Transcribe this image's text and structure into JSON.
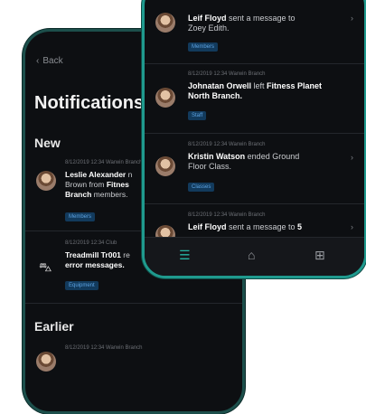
{
  "back_screen": {
    "back_label": "Back",
    "title": "Notifications",
    "section_new": "New",
    "section_earlier": "Earlier",
    "items": [
      {
        "meta": "8/12/2019   12:34   Warwin Branch",
        "name": "Leslie Alexander",
        "text_rest": " n",
        "line2": "Brown from ",
        "line2_bold": "Fitnes",
        "line3_bold": "Branch",
        "line3": " members.",
        "tag": "Members"
      },
      {
        "meta": "8/12/2019   12:34   Club",
        "line1_bold": "Treadmill Tr001",
        "line1": " re",
        "line2_bold": "error messages.",
        "tag": "Equipment"
      },
      {
        "meta": "8/12/2019   12:34   Warwin Branch"
      }
    ]
  },
  "front_screen": {
    "items": [
      {
        "name": "Leif Floyd",
        "text": " sent a message to",
        "line2": "Zoey Edith.",
        "tag": "Members"
      },
      {
        "meta": "8/12/2019   12:34   Warwin Branch",
        "name": "Johnatan Orwell",
        "text": " left ",
        "bold2": "Fitness Planet",
        "line2_bold": "North Branch.",
        "tag": "Staff"
      },
      {
        "meta": "8/12/2019   12:34   Warwin Branch",
        "name": "Kristin Watson",
        "text": " ended Ground",
        "line2": "Floor Class.",
        "tag": "Classes"
      },
      {
        "meta": "8/12/2019   12:34   Warwin Branch",
        "name": "Leif Floyd",
        "text": " sent a message to ",
        "bold2": "5"
      }
    ],
    "tabs": [
      {
        "icon": "menu-icon",
        "glyph": "☰"
      },
      {
        "icon": "home-icon",
        "glyph": "⌂"
      },
      {
        "icon": "qr-code-icon",
        "glyph": "⊞"
      }
    ]
  },
  "colors": {
    "accent": "#27b3a4",
    "tag_bg": "#123a5c",
    "tag_text": "#5da2e0",
    "background": "#0d0f12"
  }
}
